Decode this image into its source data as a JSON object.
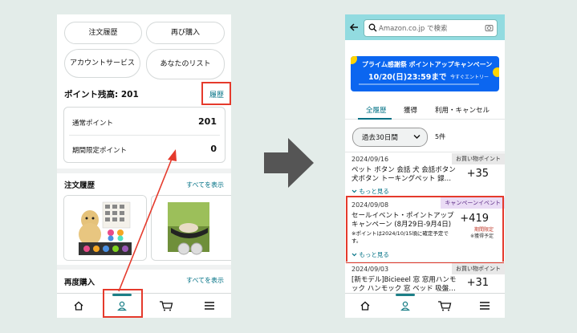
{
  "left_phone": {
    "buttons": {
      "order_history": "注文履歴",
      "buy_again": "再び購入",
      "account_service": "アカウントサービス",
      "your_lists": "あなたのリスト"
    },
    "points": {
      "title": "ポイント残高: 201",
      "history_link": "履歴",
      "regular_label": "通常ポイント",
      "regular_value": "201",
      "limited_label": "期間限定ポイント",
      "limited_value": "0"
    },
    "order_history_section": {
      "title": "注文履歴",
      "see_all": "すべてを表示"
    },
    "buy_again_section": {
      "title": "再度購入",
      "see_all": "すべてを表示"
    }
  },
  "right_phone": {
    "search": {
      "placeholder": "Amazon.co.jp で検索"
    },
    "banner": {
      "title": "プライム感謝祭 ポイントアップキャンペーン",
      "date": "10/20(日)23:59まで",
      "cta": "今すぐエントリー"
    },
    "tabs": [
      "全履歴",
      "獲得",
      "利用・キャンセル"
    ],
    "filter": {
      "selected": "過去30日間",
      "count": "5件"
    },
    "transactions": [
      {
        "date": "2024/09/16",
        "badge": "お買い物ポイント",
        "title": "ペット ボタン 会話 犬 会話ボタン 犬ボタン トーキングペット 録…",
        "amount": "+35",
        "more": "もっと見る"
      },
      {
        "date": "2024/09/08",
        "badge": "キャンペーンイベント",
        "title": "セールイベント・ポイントアップキャンペーン (8月29日-9月4日)",
        "amount": "+419",
        "sub1": "期間限定",
        "sub2": "※獲得予定",
        "note": "※ポイントは2024/10/15頃に確定予定です。",
        "more": "もっと見る"
      },
      {
        "date": "2024/09/03",
        "badge": "お買い物ポイント",
        "title": "[新モデル]Bicieeel 窓 窓用ハンモック ハンモック 窓 ベッド 吸盤…",
        "amount": "+31"
      }
    ]
  },
  "colors": {
    "accent": "#007185",
    "highlight": "#e53a2c",
    "search_bg": "#92dbe0",
    "banner": "#0b66f0"
  }
}
